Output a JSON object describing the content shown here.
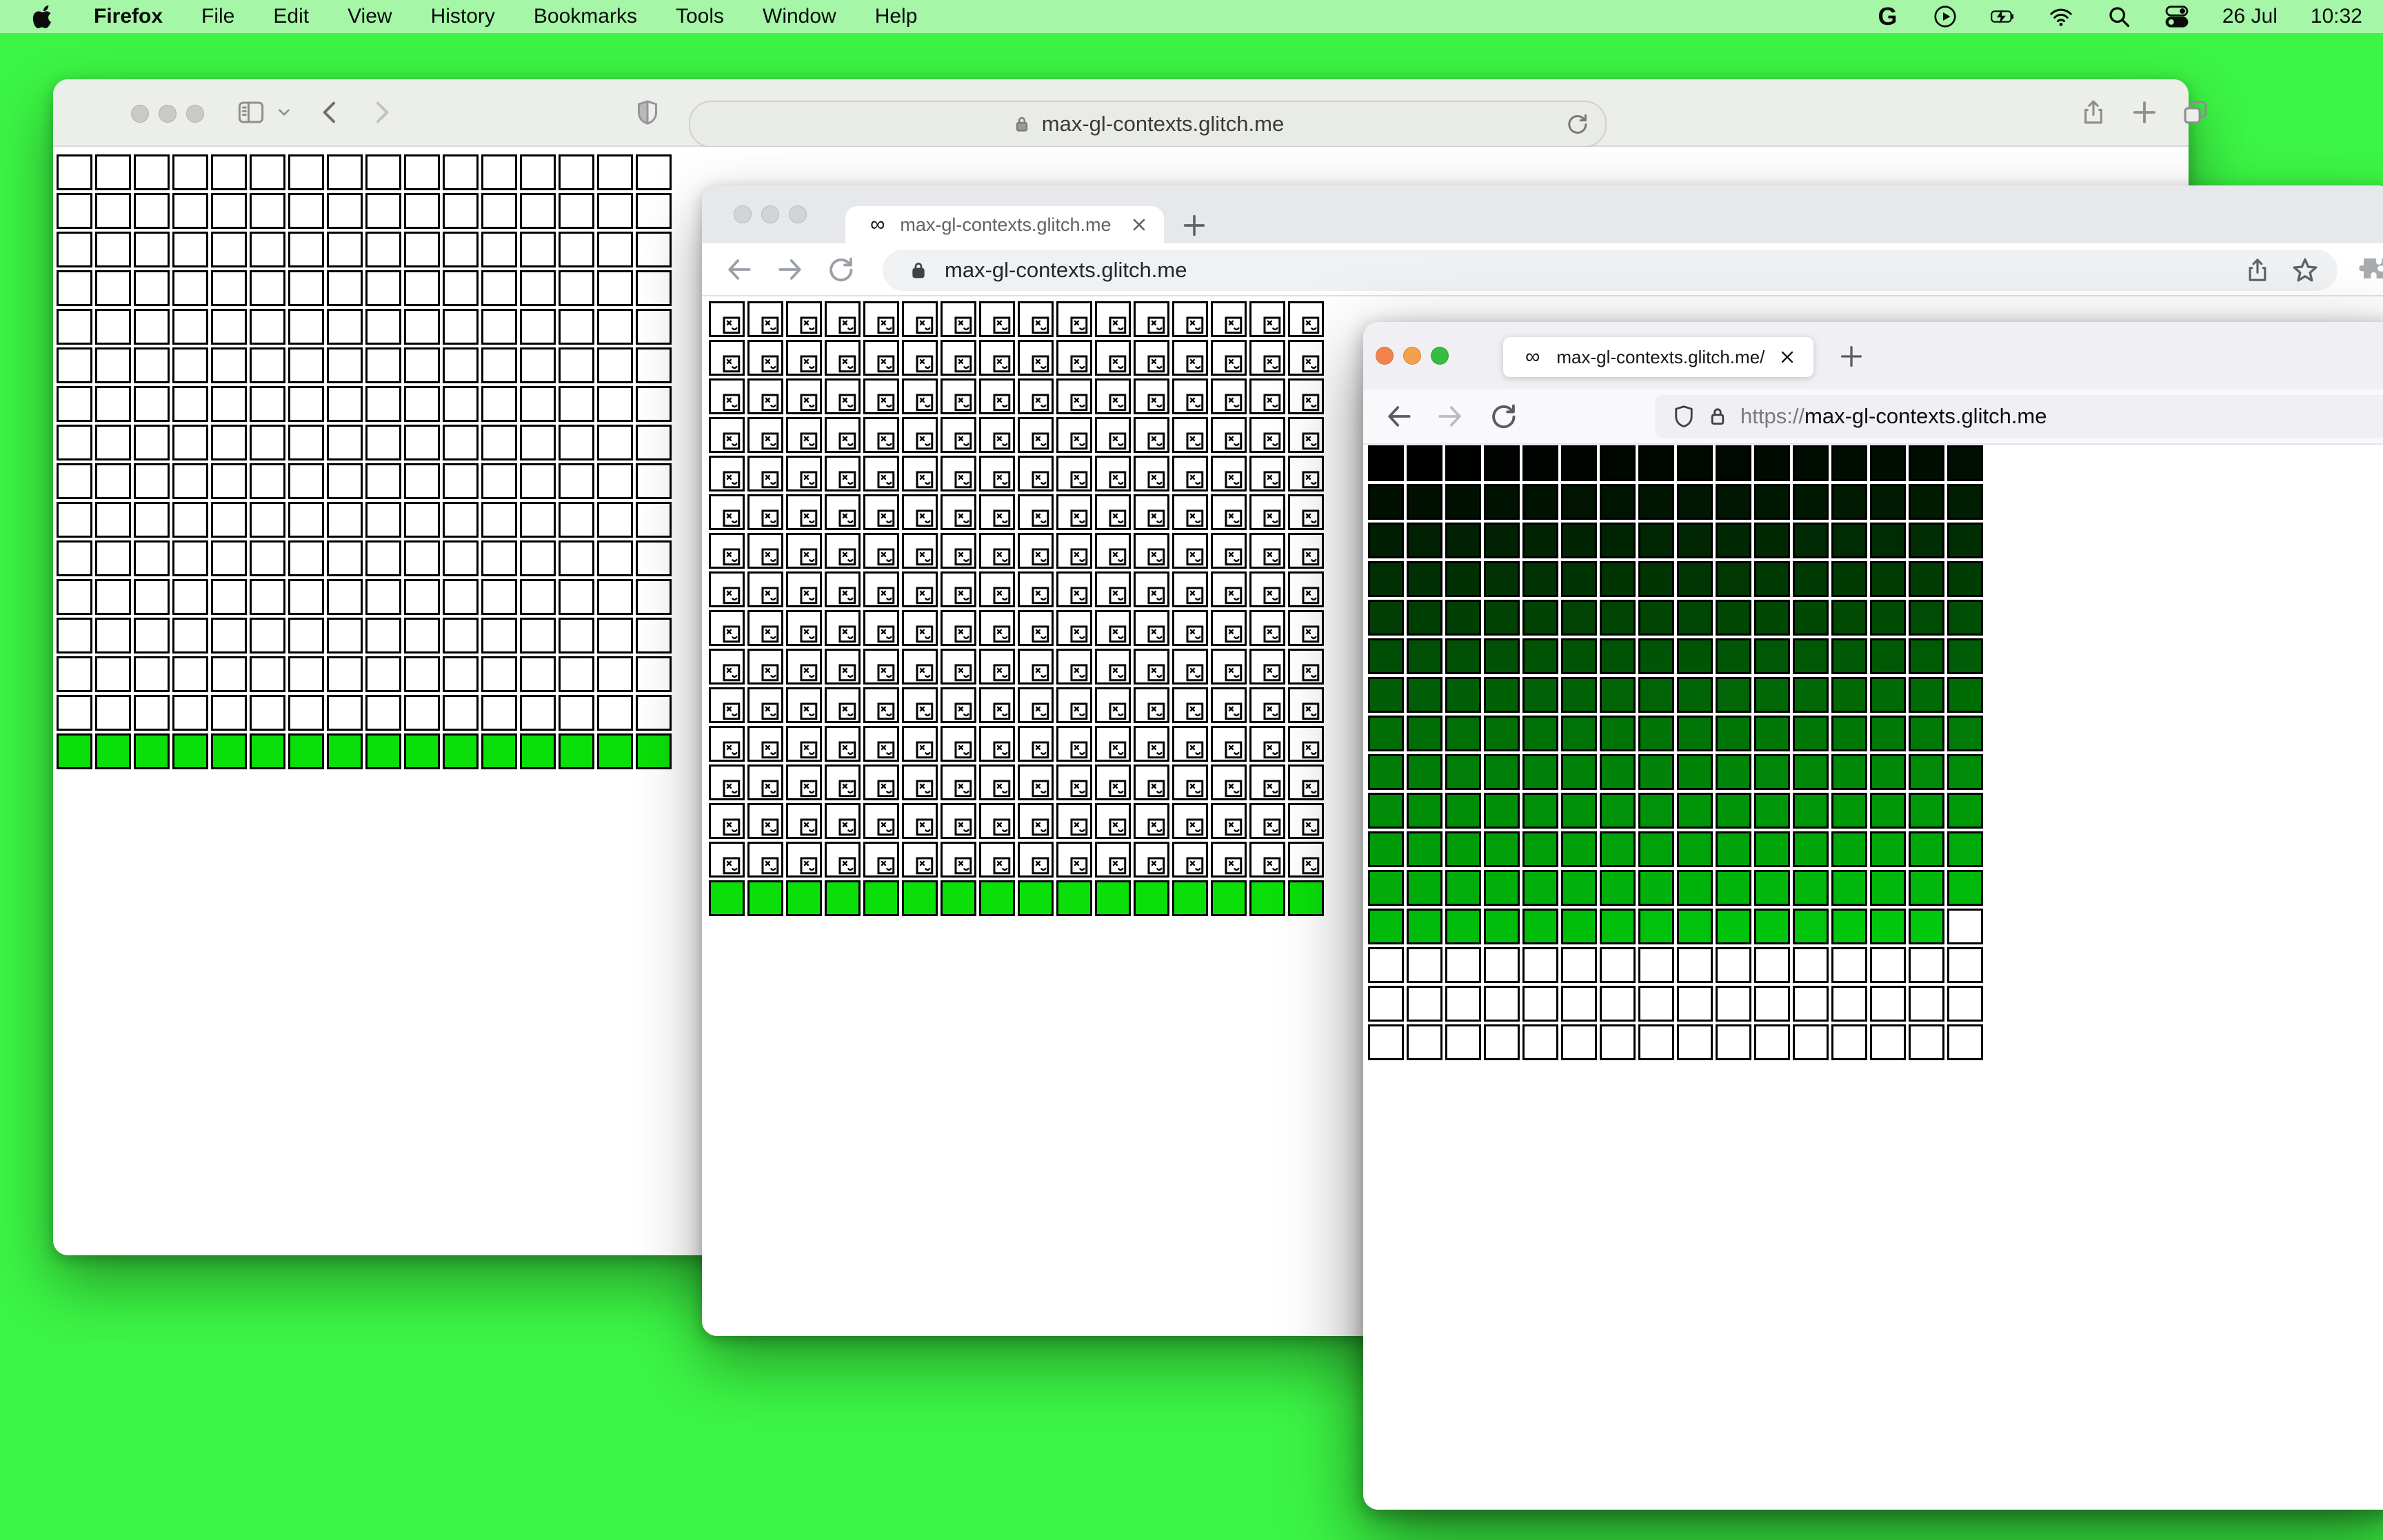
{
  "menu_bar": {
    "app_name": "Firefox",
    "menus": [
      "File",
      "Edit",
      "View",
      "History",
      "Bookmarks",
      "Tools",
      "Window",
      "Help"
    ],
    "status_icons": [
      "google-icon",
      "play-circle-icon",
      "battery-charging-icon",
      "wifi-icon",
      "search-icon",
      "control-center-icon"
    ],
    "date": "26 Jul",
    "time": "10:32"
  },
  "safari": {
    "url": "max-gl-contexts.glitch.me"
  },
  "chrome": {
    "tab_favicon": "∞",
    "tab_title": "max-gl-contexts.glitch.me",
    "url": "max-gl-contexts.glitch.me"
  },
  "firefox": {
    "tab_favicon": "∞",
    "tab_title": "max-gl-contexts.glitch.me/",
    "url_scheme": "https://",
    "url_host": "max-gl-contexts.glitch.me"
  },
  "grids": [
    {
      "id": "safari-grid",
      "browser": "safari",
      "cols": 16,
      "rows": 16,
      "pattern": "white-then-green",
      "white": "#FFFFFF",
      "green": "#0ADF0A"
    },
    {
      "id": "chrome-grid",
      "browser": "chrome",
      "cols": 16,
      "rows": 16,
      "pattern": "broken-then-green",
      "white": "#FFFFFF",
      "green": "#0ADF0A"
    },
    {
      "id": "firefox-grid",
      "browser": "firefox",
      "cols": 16,
      "rows": 16,
      "pattern": "ramp",
      "colored_cells": 207,
      "ramp_from": "#000000",
      "ramp_to": "#00C80C",
      "white": "#FFFFFF"
    }
  ],
  "colors": {
    "desktop": "#3CF544",
    "menubar": "#A5F7A7",
    "lime_row": "#0ADF0A",
    "ramp_start": "#000000",
    "ramp_end": "#00C80C",
    "ff_light_red": "#F4824D",
    "ff_light_yellow": "#F5A04A",
    "ff_light_green": "#35BD3F"
  }
}
